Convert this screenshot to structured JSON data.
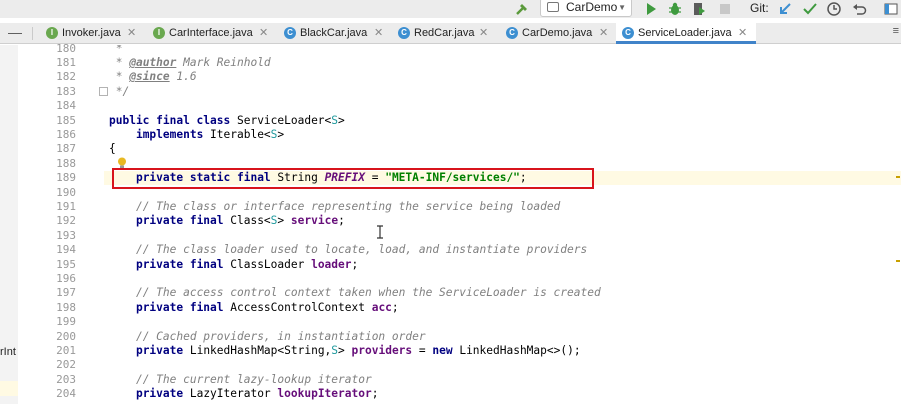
{
  "toolbar": {
    "run_config": "CarDemo",
    "git_label": "Git:",
    "icons": [
      "hammer-icon",
      "run-icon",
      "debug-icon",
      "coverage-icon",
      "stop-icon",
      "update-icon",
      "commit-icon",
      "history-icon",
      "revert-icon",
      "project-structure-icon"
    ]
  },
  "tabs": [
    {
      "label": "Invoker.java",
      "kind": "interface",
      "icon_letter": "I",
      "icon_color": "#6aa84f",
      "active": false
    },
    {
      "label": "CarInterface.java",
      "kind": "interface",
      "icon_letter": "I",
      "icon_color": "#6aa84f",
      "active": false
    },
    {
      "label": "BlackCar.java",
      "kind": "class",
      "icon_letter": "C",
      "icon_color": "#3d8fd1",
      "active": false
    },
    {
      "label": "RedCar.java",
      "kind": "class",
      "icon_letter": "C",
      "icon_color": "#3d8fd1",
      "active": false
    },
    {
      "label": "CarDemo.java",
      "kind": "class",
      "icon_letter": "C",
      "icon_color": "#3d8fd1",
      "active": false
    },
    {
      "label": "ServiceLoader.java",
      "kind": "class",
      "icon_letter": "C",
      "icon_color": "#3d8fd1",
      "active": true
    }
  ],
  "side_panel": {
    "label": "rInt"
  },
  "line_numbers": [
    "180",
    "181",
    "182",
    "183",
    "184",
    "185",
    "186",
    "187",
    "188",
    "189",
    "190",
    "191",
    "192",
    "193",
    "194",
    "195",
    "196",
    "197",
    "198",
    "199",
    "200",
    "201",
    "202",
    "203",
    "204"
  ],
  "code": {
    "l180": "*",
    "l181_tag": "@author",
    "l181_rest": " Mark Reinhold",
    "l182_tag": "@since",
    "l182_rest": " 1.6",
    "l183": " */",
    "l185_kw": "public final class",
    "l185_name": " ServiceLoader<",
    "l185_tp": "S",
    "l185_end": ">",
    "l186_kw": "implements",
    "l186_name": " Iterable<",
    "l186_tp": "S",
    "l186_end": ">",
    "l187": "{",
    "l189_kw": "private static final",
    "l189_type": " String ",
    "l189_field": "PREFIX",
    "l189_eq": " = ",
    "l189_str": "\"META-INF/services/\"",
    "l189_end": ";",
    "l191": "// The class or interface representing the service being loaded",
    "l192_kw": "private final",
    "l192_type": " Class<",
    "l192_tp": "S",
    "l192_type2": "> ",
    "l192_field": "service",
    "l192_end": ";",
    "l194": "// The class loader used to locate, load, and instantiate providers",
    "l195_kw": "private final",
    "l195_type": " ClassLoader ",
    "l195_field": "loader",
    "l195_end": ";",
    "l197": "// The access control context taken when the ServiceLoader is created",
    "l198_kw": "private final",
    "l198_type": " AccessControlContext ",
    "l198_field": "acc",
    "l198_end": ";",
    "l200": "// Cached providers, in instantiation order",
    "l201_kw": "private",
    "l201_type": " LinkedHashMap<String,",
    "l201_tp": "S",
    "l201_type2": "> ",
    "l201_field": "providers",
    "l201_eq": " = ",
    "l201_new": "new",
    "l201_rest": " LinkedHashMap<>();",
    "l203": "// The current lazy-lookup iterator",
    "l204_kw": "private",
    "l204_type": " LazyIterator ",
    "l204_field": "lookupIterator",
    "l204_end": ";"
  }
}
